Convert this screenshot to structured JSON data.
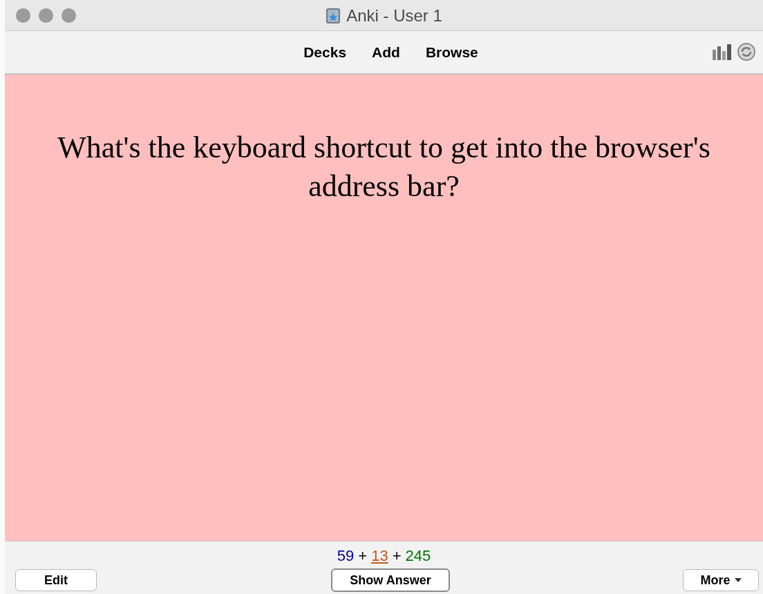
{
  "window": {
    "title": "Anki - User 1"
  },
  "toolbar": {
    "links": [
      "Decks",
      "Add",
      "Browse"
    ]
  },
  "card": {
    "question": "What's the keyboard shortcut to get into the browser's address bar?"
  },
  "counts": [
    {
      "value": "59",
      "color": "#000099",
      "current": false
    },
    {
      "value": "13",
      "color": "#c35617",
      "current": true
    },
    {
      "value": "245",
      "color": "#007700",
      "current": false
    }
  ],
  "count_separator": "+",
  "buttons": {
    "edit": "Edit",
    "answer": "Show Answer",
    "more": "More"
  }
}
